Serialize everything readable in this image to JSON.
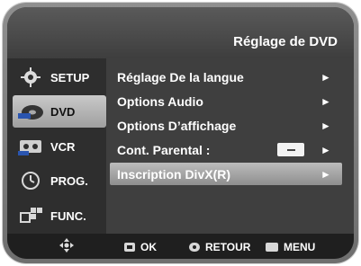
{
  "header": {
    "title": "Réglage de DVD"
  },
  "sidebar": {
    "items": [
      {
        "label": "SETUP",
        "icon": "gear-icon"
      },
      {
        "label": "DVD",
        "icon": "dvd-disc-icon"
      },
      {
        "label": "VCR",
        "icon": "vcr-tape-icon"
      },
      {
        "label": "PROG.",
        "icon": "clock-icon"
      },
      {
        "label": "FUNC.",
        "icon": "function-blocks-icon"
      }
    ],
    "active_index": 1
  },
  "menu": {
    "items": [
      {
        "label": "Réglage De la langue"
      },
      {
        "label": "Options Audio"
      },
      {
        "label": "Options D’affichage"
      },
      {
        "label": "Cont. Parental :"
      },
      {
        "label": "Inscription DivX(R)"
      }
    ],
    "selected_index": 4,
    "arrow_glyph": "►"
  },
  "footer": {
    "ok_label": "OK",
    "return_label": "RETOUR",
    "menu_label": "MENU"
  }
}
